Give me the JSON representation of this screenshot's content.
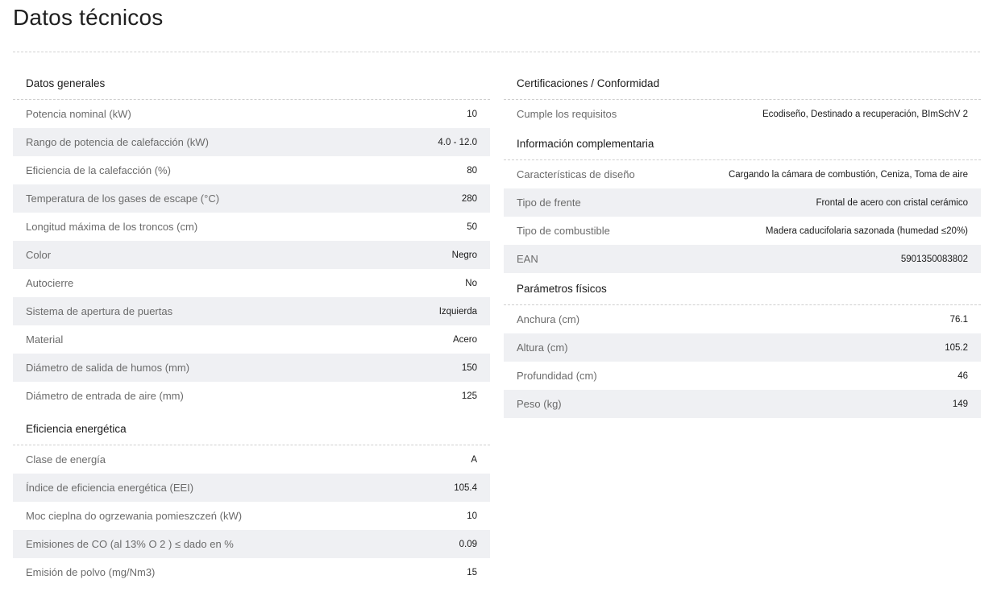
{
  "page_title": "Datos técnicos",
  "left": [
    {
      "title": "Datos generales",
      "rows": [
        {
          "label": "Potencia nominal (kW)",
          "value": "10"
        },
        {
          "label": "Rango de potencia de calefacción (kW)",
          "value": "4.0 - 12.0"
        },
        {
          "label": "Eficiencia de la calefacción (%)",
          "value": "80"
        },
        {
          "label": "Temperatura de los gases de escape (°C)",
          "value": "280"
        },
        {
          "label": "Longitud máxima de los troncos (cm)",
          "value": "50"
        },
        {
          "label": "Color",
          "value": "Negro"
        },
        {
          "label": "Autocierre",
          "value": "No"
        },
        {
          "label": "Sistema de apertura de puertas",
          "value": "Izquierda"
        },
        {
          "label": "Material",
          "value": "Acero"
        },
        {
          "label": "Diámetro de salida de humos (mm)",
          "value": "150"
        },
        {
          "label": "Diámetro de entrada de aire (mm)",
          "value": "125"
        }
      ]
    },
    {
      "title": "Eficiencia energética",
      "rows": [
        {
          "label": "Clase de energía",
          "value": "A"
        },
        {
          "label": "Índice de eficiencia energética (EEI)",
          "value": "105.4"
        },
        {
          "label": "Moc cieplna do ogrzewania pomieszczeń (kW)",
          "value": "10"
        },
        {
          "label": "Emisiones de CO (al 13% O 2 ) ≤ dado en %",
          "value": "0.09"
        },
        {
          "label": "Emisión de polvo (mg/Nm3)",
          "value": "15"
        }
      ]
    }
  ],
  "right": [
    {
      "title": "Certificaciones / Conformidad",
      "rows": [
        {
          "label": "Cumple los requisitos",
          "value": "Ecodiseño, Destinado a recuperación, BImSchV 2"
        }
      ]
    },
    {
      "title": "Información complementaria",
      "rows": [
        {
          "label": "Características de diseño",
          "value": "Cargando la cámara de combustión, Ceniza, Toma de aire"
        },
        {
          "label": "Tipo de frente",
          "value": "Frontal de acero con cristal cerámico"
        },
        {
          "label": "Tipo de combustible",
          "value": "Madera caducifolaria sazonada (humedad ≤20%)"
        },
        {
          "label": "EAN",
          "value": "5901350083802"
        }
      ]
    },
    {
      "title": "Parámetros físicos",
      "rows": [
        {
          "label": "Anchura (cm)",
          "value": "76.1"
        },
        {
          "label": "Altura (cm)",
          "value": "105.2"
        },
        {
          "label": "Profundidad (cm)",
          "value": "46"
        },
        {
          "label": "Peso (kg)",
          "value": "149"
        }
      ]
    }
  ]
}
